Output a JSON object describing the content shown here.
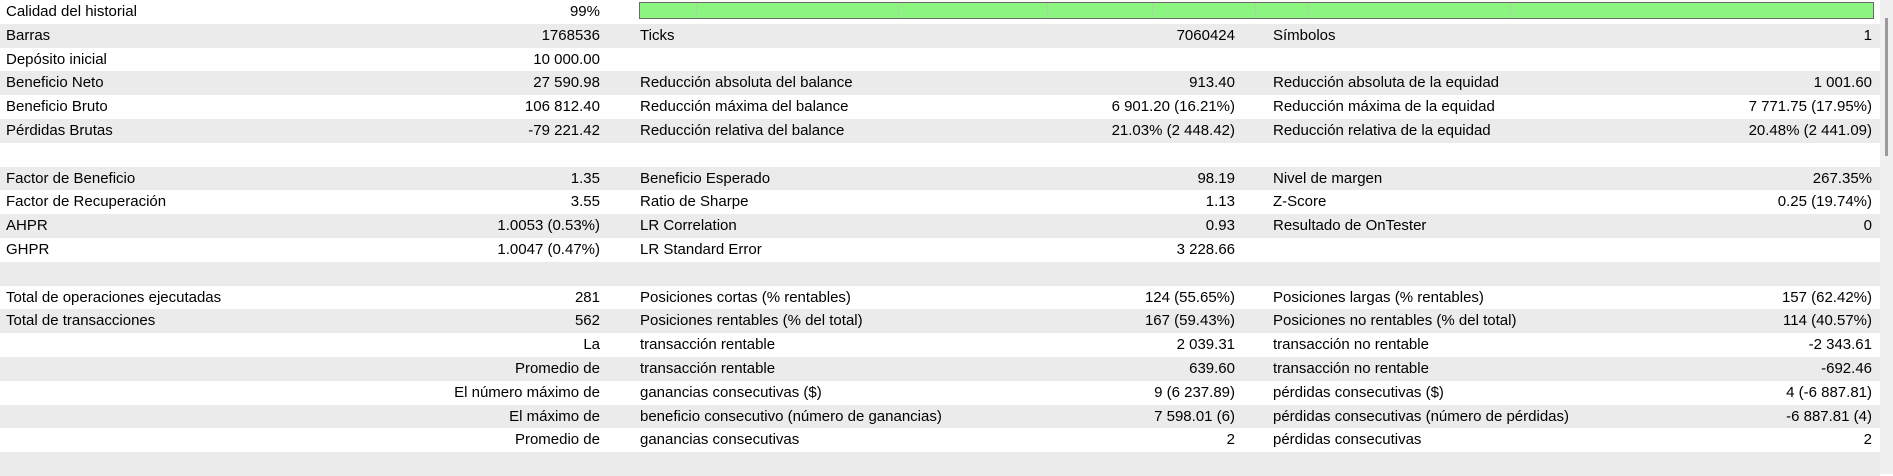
{
  "rows": [
    {
      "c1_label": "Calidad del historial",
      "c1_value": "99%",
      "has_bar": true,
      "quality": 0.99
    },
    {
      "c1_label": "Barras",
      "c1_value": "1768536",
      "c2_label": "Ticks",
      "c2_value": "7060424",
      "c3_label": "Símbolos",
      "c3_value": "1"
    },
    {
      "c1_label": "Depósito inicial",
      "c1_value": "10 000.00"
    },
    {
      "c1_label": "Beneficio Neto",
      "c1_value": "27 590.98",
      "c2_label": "Reducción absoluta del balance",
      "c2_value": "913.40",
      "c3_label": "Reducción absoluta de la equidad",
      "c3_value": "1 001.60"
    },
    {
      "c1_label": "Beneficio Bruto",
      "c1_value": "106 812.40",
      "c2_label": "Reducción máxima del balance",
      "c2_value": "6 901.20 (16.21%)",
      "c3_label": "Reducción máxima de la equidad",
      "c3_value": "7 771.75 (17.95%)"
    },
    {
      "c1_label": "Pérdidas Brutas",
      "c1_value": "-79 221.42",
      "c2_label": "Reducción relativa del balance",
      "c2_value": "21.03% (2 448.42)",
      "c3_label": "Reducción relativa de la equidad",
      "c3_value": "20.48% (2 441.09)"
    },
    {},
    {
      "c1_label": "Factor de Beneficio",
      "c1_value": "1.35",
      "c2_label": "Beneficio Esperado",
      "c2_value": "98.19",
      "c3_label": "Nivel de margen",
      "c3_value": "267.35%"
    },
    {
      "c1_label": "Factor de Recuperación",
      "c1_value": "3.55",
      "c2_label": "Ratio de Sharpe",
      "c2_value": "1.13",
      "c3_label": "Z-Score",
      "c3_value": "0.25 (19.74%)"
    },
    {
      "c1_label": "AHPR",
      "c1_value": "1.0053 (0.53%)",
      "c2_label": "LR Correlation",
      "c2_value": "0.93",
      "c3_label": "Resultado de OnTester",
      "c3_value": "0"
    },
    {
      "c1_label": "GHPR",
      "c1_value": "1.0047 (0.47%)",
      "c2_label": "LR Standard Error",
      "c2_value": "3 228.66"
    },
    {},
    {
      "c1_label": "Total de operaciones ejecutadas",
      "c1_value": "281",
      "c2_label": "Posiciones cortas (% rentables)",
      "c2_value": "124 (55.65%)",
      "c3_label": "Posiciones largas (% rentables)",
      "c3_value": "157 (62.42%)"
    },
    {
      "c1_label": "Total de transacciones",
      "c1_value": "562",
      "c2_label": "Posiciones rentables (% del total)",
      "c2_value": "167 (59.43%)",
      "c3_label": "Posiciones no rentables (% del total)",
      "c3_value": "114 (40.57%)"
    },
    {
      "c1_value": "La",
      "c2_label": "transacción rentable",
      "c2_value": "2 039.31",
      "c3_label": "transacción no rentable",
      "c3_value": "-2 343.61"
    },
    {
      "c1_value": "Promedio de",
      "c2_label": "transacción rentable",
      "c2_value": "639.60",
      "c3_label": "transacción no rentable",
      "c3_value": "-692.46"
    },
    {
      "c1_value": "El número máximo de",
      "c2_label": "ganancias consecutivas ($)",
      "c2_value": "9 (6 237.89)",
      "c3_label": "pérdidas consecutivas ($)",
      "c3_value": "4 (-6 887.81)"
    },
    {
      "c1_value": "El máximo de",
      "c2_label": "beneficio consecutivo (número de ganancias)",
      "c2_value": "7 598.01 (6)",
      "c3_label": "pérdidas consecutivas (número de pérdidas)",
      "c3_value": "-6 887.81 (4)"
    },
    {
      "c1_value": "Promedio de",
      "c2_label": "ganancias consecutivas",
      "c2_value": "2",
      "c3_label": "pérdidas consecutivas",
      "c3_value": "2"
    },
    {}
  ],
  "colors": {
    "bar_fill": "#8cf57f",
    "row_alt": "#ebebeb"
  }
}
